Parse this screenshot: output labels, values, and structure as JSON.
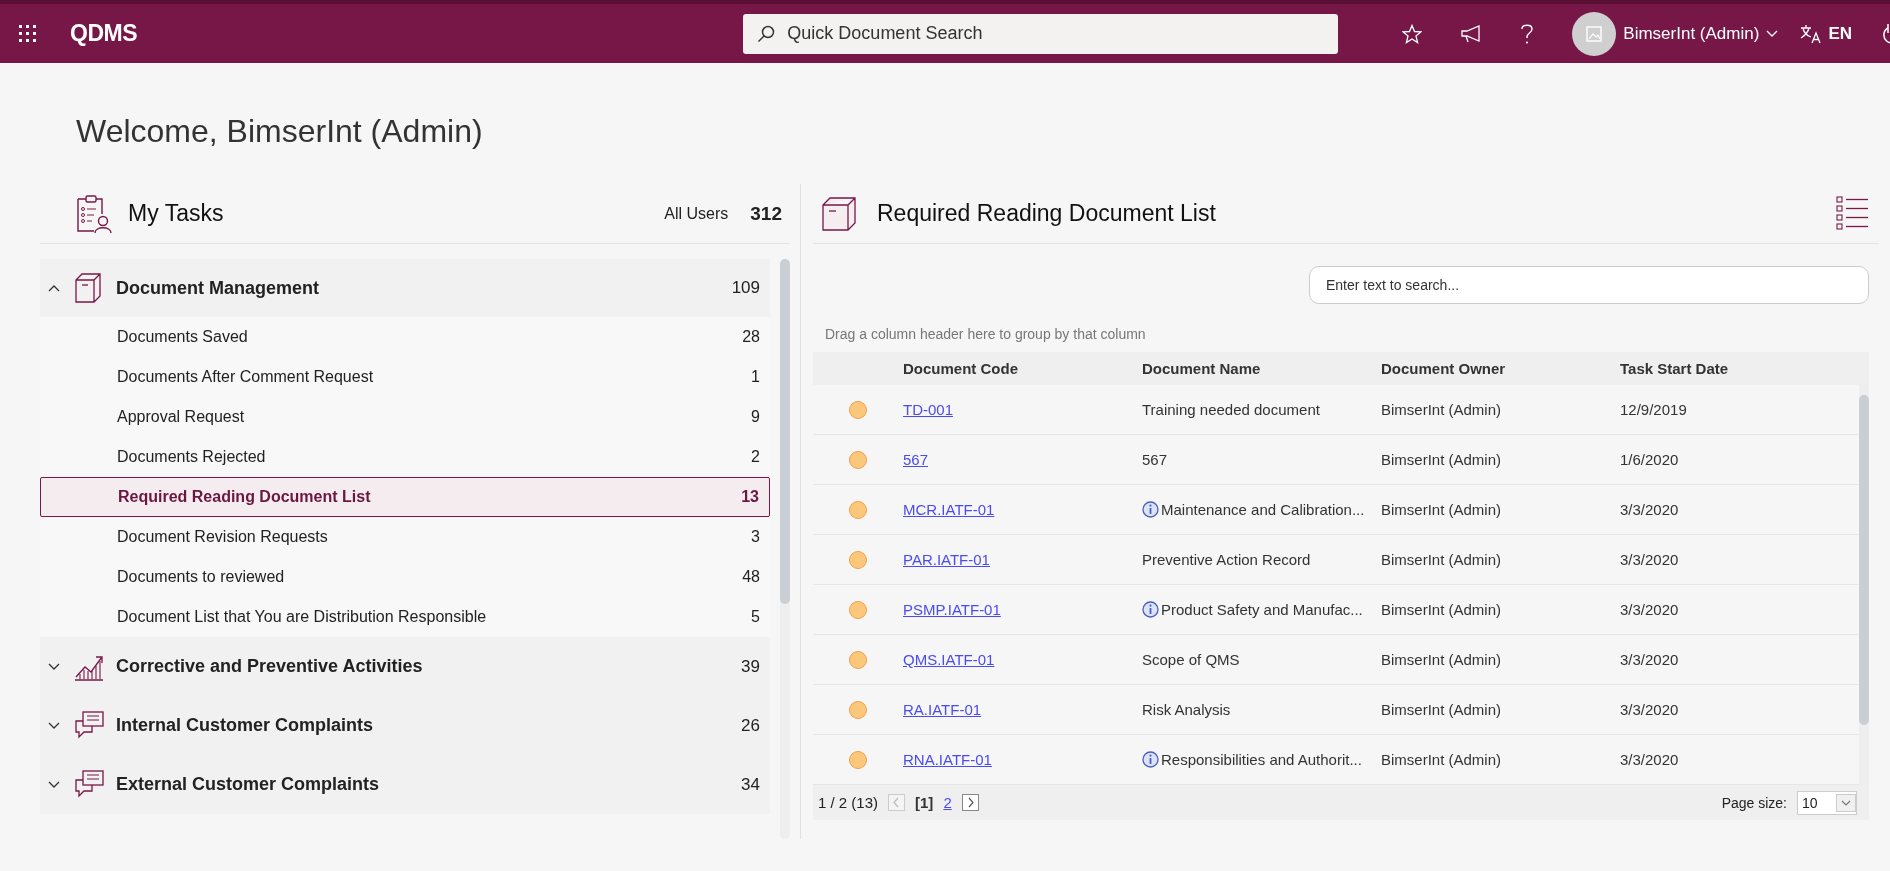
{
  "topbar": {
    "logo": "QDMS",
    "search_placeholder": "Quick Document Search",
    "user": "BimserInt (Admin)",
    "language": "EN"
  },
  "welcome": "Welcome, BimserInt (Admin)",
  "tasks": {
    "title": "My Tasks",
    "all_users_label": "All Users",
    "all_users_count": "312",
    "groups": [
      {
        "title": "Document Management",
        "count": "109",
        "kind": "box",
        "expanded": true,
        "items": [
          {
            "label": "Documents Saved",
            "count": "28",
            "selected": false
          },
          {
            "label": "Documents After Comment Request",
            "count": "1",
            "selected": false
          },
          {
            "label": "Approval Request",
            "count": "9",
            "selected": false
          },
          {
            "label": "Documents Rejected",
            "count": "2",
            "selected": false
          },
          {
            "label": "Required Reading Document List",
            "count": "13",
            "selected": true
          },
          {
            "label": "Document Revision Requests",
            "count": "3",
            "selected": false
          },
          {
            "label": "Documents to reviewed",
            "count": "48",
            "selected": false
          },
          {
            "label": "Document List that You are Distribution Responsible",
            "count": "5",
            "selected": false
          }
        ]
      },
      {
        "title": "Corrective and Preventive Activities",
        "count": "39",
        "kind": "chart",
        "expanded": false
      },
      {
        "title": "Internal Customer Complaints",
        "count": "26",
        "kind": "chat",
        "expanded": false
      },
      {
        "title": "External Customer Complaints",
        "count": "34",
        "kind": "chat",
        "expanded": false
      }
    ]
  },
  "list": {
    "title": "Required Reading Document List",
    "search_placeholder": "Enter text to search...",
    "group_hint": "Drag a column header here to group by that column",
    "columns": [
      "Document Code",
      "Document Name",
      "Document Owner",
      "Task Start Date"
    ],
    "rows": [
      {
        "code": "TD-001",
        "name": "Training needed document",
        "info": false,
        "owner": "BimserInt (Admin)",
        "date": "12/9/2019"
      },
      {
        "code": "567",
        "name": "567",
        "info": false,
        "owner": "BimserInt (Admin)",
        "date": "1/6/2020"
      },
      {
        "code": "MCR.IATF-01",
        "name": "Maintenance and Calibration...",
        "info": true,
        "owner": "BimserInt (Admin)",
        "date": "3/3/2020"
      },
      {
        "code": "PAR.IATF-01",
        "name": "Preventive Action Record",
        "info": false,
        "owner": "BimserInt (Admin)",
        "date": "3/3/2020"
      },
      {
        "code": "PSMP.IATF-01",
        "name": "Product Safety and Manufac...",
        "info": true,
        "owner": "BimserInt (Admin)",
        "date": "3/3/2020"
      },
      {
        "code": "QMS.IATF-01",
        "name": "Scope of QMS",
        "info": false,
        "owner": "BimserInt (Admin)",
        "date": "3/3/2020"
      },
      {
        "code": "RA.IATF-01",
        "name": "Risk Analysis",
        "info": false,
        "owner": "BimserInt (Admin)",
        "date": "3/3/2020"
      },
      {
        "code": "RNA.IATF-01",
        "name": "Responsibilities and Authorit...",
        "info": true,
        "owner": "BimserInt (Admin)",
        "date": "3/3/2020"
      }
    ],
    "pager": {
      "summary": "1 / 2 (13)",
      "pages": [
        {
          "label": "[1]",
          "selected": true
        },
        {
          "label": "2",
          "selected": false
        }
      ],
      "page_size_label": "Page size:",
      "page_size": "10"
    }
  }
}
